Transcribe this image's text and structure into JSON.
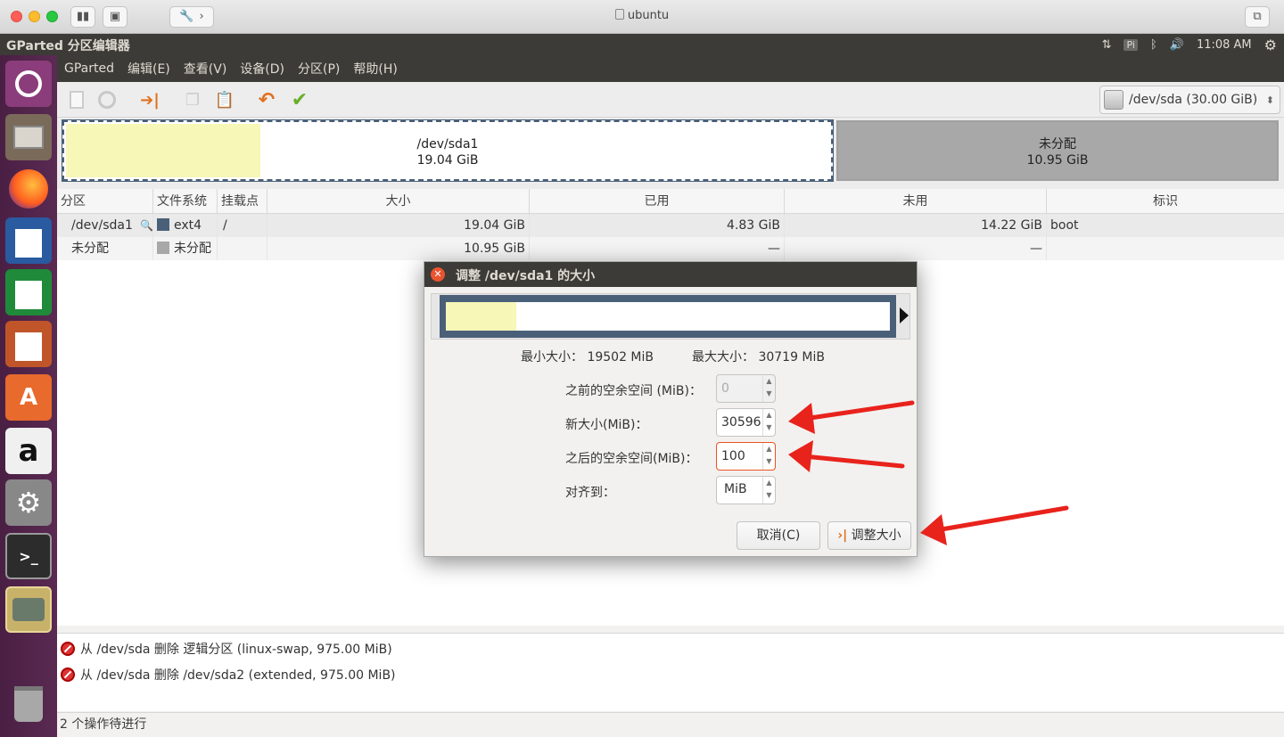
{
  "window": {
    "title": "ubuntu"
  },
  "topbar": {
    "app_title": "GParted 分区编辑器",
    "keyboard": "Pi",
    "time": "11:08 AM"
  },
  "menu": [
    "GParted",
    "编辑(E)",
    "查看(V)",
    "设备(D)",
    "分区(P)",
    "帮助(H)"
  ],
  "device": {
    "label": "/dev/sda  (30.00 GiB)"
  },
  "disk_map": {
    "sda1": {
      "name": "/dev/sda1",
      "size": "19.04 GiB",
      "used_fraction": 0.25
    },
    "unallocated": {
      "name": "未分配",
      "size": "10.95 GiB"
    }
  },
  "table": {
    "headers": [
      "分区",
      "文件系统",
      "挂载点",
      "大小",
      "已用",
      "未用",
      "标识"
    ],
    "rows": [
      {
        "partition": "/dev/sda1",
        "fs": "ext4",
        "fs_color": "#4a6078",
        "mount": "/",
        "size": "19.04 GiB",
        "used": "4.83 GiB",
        "unused": "14.22 GiB",
        "flags": "boot"
      },
      {
        "partition": "未分配",
        "fs": "未分配",
        "fs_color": "#a8a8a8",
        "mount": "",
        "size": "10.95 GiB",
        "used": "—",
        "unused": "—",
        "flags": ""
      }
    ]
  },
  "dialog": {
    "title": "调整 /dev/sda1 的大小",
    "min_size": "最小大小： 19502 MiB",
    "max_size": "最大大小： 30719 MiB",
    "free_before_label": "之前的空余空间 (MiB)：",
    "free_before_value": "0",
    "new_size_label": "新大小(MiB)：",
    "new_size_value": "30596",
    "free_after_label": "之后的空余空间(MiB)：",
    "free_after_value": "100",
    "align_label": "对齐到：",
    "align_value": "MiB",
    "cancel_label": "取消(C)",
    "resize_label": "调整大小"
  },
  "log": [
    "从 /dev/sda 删除 逻辑分区 (linux-swap, 975.00 MiB)",
    "从 /dev/sda 删除 /dev/sda2 (extended, 975.00 MiB)"
  ],
  "status": "2 个操作待进行",
  "colors": {
    "ubuntu_dark": "#3c3b37",
    "launcher": "#5e2750",
    "ext4": "#4a6078",
    "used": "#f7f7b8",
    "unallocated": "#a8a8a8",
    "annotation": "#e8231c"
  }
}
